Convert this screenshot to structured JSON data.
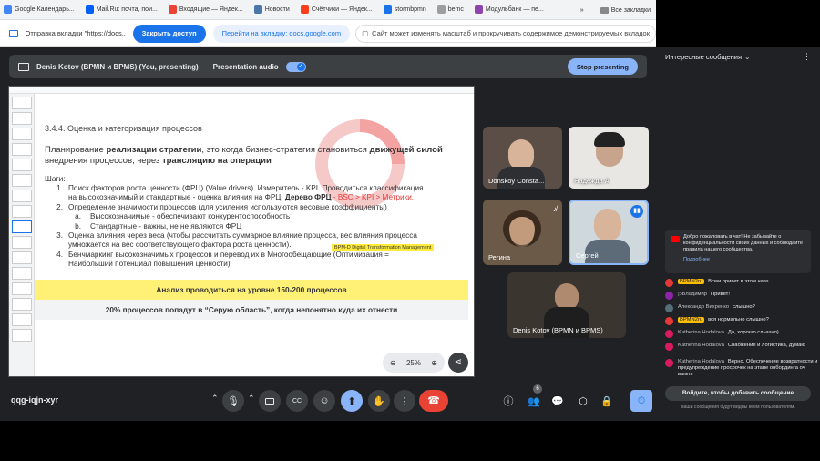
{
  "bookmarks": [
    {
      "label": "Google Календарь...",
      "color": "#4285f4"
    },
    {
      "label": "Mail.Ru: почта, пои...",
      "color": "#005ff9"
    },
    {
      "label": "Входящие — Яндек...",
      "color": "#ea4335"
    },
    {
      "label": "Новости",
      "color": "#4a76a8"
    },
    {
      "label": "Счётчики — Яндек...",
      "color": "#fc3f1d"
    },
    {
      "label": "stormbpmn",
      "color": "#1a73e8"
    },
    {
      "label": "bemc",
      "color": "#9e9e9e"
    },
    {
      "label": "Модульбанк — пе...",
      "color": "#8e44ad"
    }
  ],
  "bookmarks_right": "Все закладки",
  "sharebar": {
    "tab_text": "Отправка вкладки \"https://docs....",
    "stop_btn": "Закрыть доступ",
    "goto_btn": "Перейти на вкладку: docs.google.com",
    "info_text": "Сайт может изменять масштаб и прокручивать содержимое демонстрируемых вкладок"
  },
  "presbar": {
    "presenter": "Denis Kotov (BPMN и BPMS) (You, presenting)",
    "audio_label": "Presentation audio",
    "stop_btn": "Stop presenting"
  },
  "slide": {
    "heading": "3.4.4. Оценка и категоризация процессов",
    "intro_1": "Планирование ",
    "intro_b1": "реализации стратегии",
    "intro_2": ", это когда бизнес-стратегия становиться ",
    "intro_b2": "движущей силой",
    "intro_3": "внедрения процессов, через ",
    "intro_b3": "трансляцию на операции",
    "steps_title": "Шаги:",
    "step1_num": "1.",
    "step1_a": "Поиск факторов роста ценности (ФРЦ) (Value drivers). Измеритель - KPI. Проводиться классификация",
    "step1_b": "на высокозначимый и стандартные - оценка влияния на ФРЦ. ",
    "step1_bold": "Дерево ФРЦ",
    "step1_red": " - BSC > KPI > Метрики.",
    "step2_num": "2.",
    "step2": "Определение значимости процессов (для усиления используются весовые коэффициенты)",
    "step2a_num": "a.",
    "step2a": "Высокозначимые - обеспечивают конкурентоспособность",
    "step2b_num": "b.",
    "step2b": "Стандартные - важны, не не являются ФРЦ",
    "step3_num": "3.",
    "step3_a": "Оценка влияния через веса (чтобы рассчитать суммарное влияние процесса, вес влияния процесса",
    "step3_b": "умножается на вес соответствующего фактора роста ценности).",
    "tooltip": "BPM-D Digital Transformation Management",
    "step4_num": "4.",
    "step4_a": "Бенчмаркинг высокозначимых процессов и перевод их в Многообещающие (Оптимизация =",
    "step4_b": "Наибольший потенциал повышения ценности)",
    "banner": "Анализ проводиться на уровне 150-200 процессов",
    "footer": "20% процессов попадут в “Серую область”, когда непонятно куда их отнести",
    "zoom": "25%"
  },
  "participants": [
    {
      "name": "Donskoy Constа..."
    },
    {
      "name": "Надежда А"
    },
    {
      "name": "Регина"
    },
    {
      "name": "Сергей"
    },
    {
      "name": "Denis Kotov (BPMN и BPMS)"
    }
  ],
  "meeting_code": "qqg-iqjn-xyr",
  "people_count": "6",
  "chat": {
    "title": "Интересные сообщения",
    "notice": "Добро пожаловать в чат! Не забывайте о конфиденциальности своих данных и соблюдайте правила нашего сообщества.",
    "notice_link": "Подробнее",
    "messages": [
      {
        "author": "BPMN2ru",
        "text": "Всем привет в этом чате",
        "badge": true,
        "color": "#e53935"
      },
      {
        "author": "▷Владимир",
        "text": "Привет!",
        "badge": false,
        "color": "#8e24aa"
      },
      {
        "author": "Александр Вихренко",
        "text": "слышно?",
        "badge": false,
        "color": "#546e7a"
      },
      {
        "author": "BPMN2ru",
        "text": "вся нормально слышно?",
        "badge": true,
        "color": "#e53935"
      },
      {
        "author": "Katherina Hodalova",
        "text": "Да, хорошо слышно)",
        "badge": false,
        "color": "#d81b60"
      },
      {
        "author": "Katherina Hodalova",
        "text": "Снабжение и логистика, думаю",
        "badge": false,
        "color": "#d81b60"
      },
      {
        "author": "Katherina Hodalova",
        "text": "Верно. Обеспечение возвратности и предупреждение просрочек на этапе онбординга оч важно",
        "badge": false,
        "color": "#d81b60"
      }
    ],
    "login_btn": "Войдите, чтобы добавить сообщение",
    "footer_note": "Ваши сообщения будут видны всем пользователям."
  }
}
